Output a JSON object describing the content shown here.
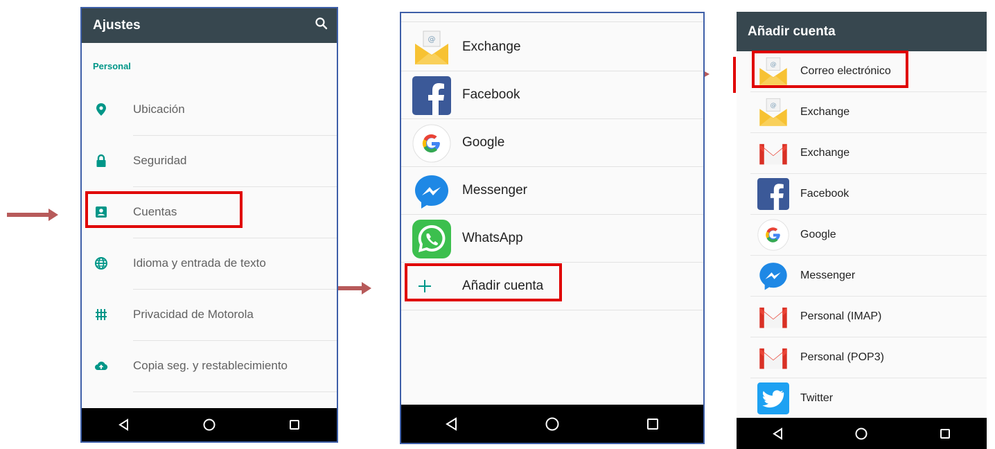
{
  "colors": {
    "accent": "#009688",
    "header": "#37474f",
    "highlight": "#e00000",
    "arrow": "#b75a5a"
  },
  "settings": {
    "title": "Ajustes",
    "section": "Personal",
    "items": [
      {
        "label": "Ubicación",
        "icon": "location-icon"
      },
      {
        "label": "Seguridad",
        "icon": "lock-icon"
      },
      {
        "label": "Cuentas",
        "icon": "account-icon"
      },
      {
        "label": "Idioma y entrada de texto",
        "icon": "globe-icon"
      },
      {
        "label": "Privacidad de Motorola",
        "icon": "privacy-icon"
      },
      {
        "label": "Copia seg. y restablecimiento",
        "icon": "cloud-upload-icon"
      }
    ]
  },
  "accounts": {
    "items": [
      {
        "label": "Exchange",
        "icon": "email-icon"
      },
      {
        "label": "Facebook",
        "icon": "facebook-icon"
      },
      {
        "label": "Google",
        "icon": "google-icon"
      },
      {
        "label": "Messenger",
        "icon": "messenger-icon"
      },
      {
        "label": "WhatsApp",
        "icon": "whatsapp-icon"
      }
    ],
    "add_label": "Añadir cuenta"
  },
  "add_account": {
    "title": "Añadir cuenta",
    "items": [
      {
        "label": "Correo electrónico",
        "icon": "email-icon"
      },
      {
        "label": "Exchange",
        "icon": "email-icon"
      },
      {
        "label": "Exchange",
        "icon": "gmail-icon"
      },
      {
        "label": "Facebook",
        "icon": "facebook-icon"
      },
      {
        "label": "Google",
        "icon": "google-icon"
      },
      {
        "label": "Messenger",
        "icon": "messenger-icon"
      },
      {
        "label": "Personal (IMAP)",
        "icon": "gmail-icon"
      },
      {
        "label": "Personal (POP3)",
        "icon": "gmail-icon"
      },
      {
        "label": "Twitter",
        "icon": "twitter-icon"
      }
    ]
  }
}
